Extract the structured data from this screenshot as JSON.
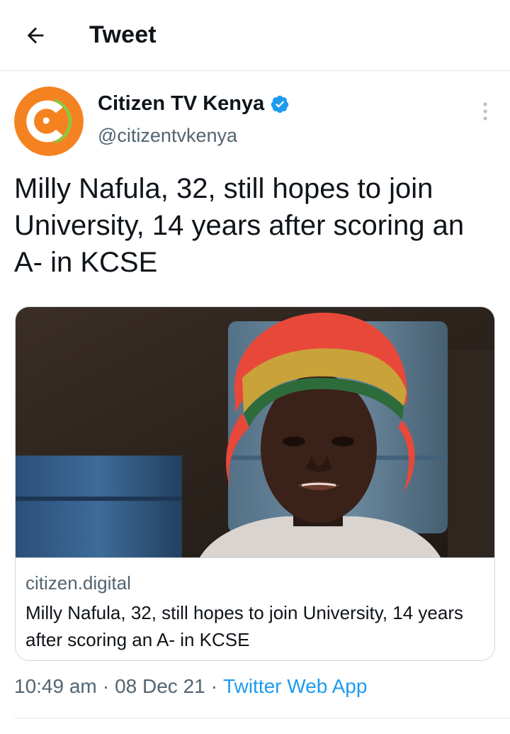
{
  "topbar": {
    "back_icon": "arrow-left-icon",
    "title": "Tweet"
  },
  "author": {
    "display_name": "Citizen TV Kenya",
    "handle": "@citizentvkenya",
    "verified": true,
    "verified_color": "#1d9bf0",
    "avatar_colors": {
      "orange": "#f58220",
      "green": "#8dc63f"
    }
  },
  "tweet": {
    "text": "Milly Nafula, 32, still hopes to join University, 14 years after scoring an A- in KCSE"
  },
  "link_card": {
    "image_icon": "news-photo",
    "domain": "citizen.digital",
    "title": "Milly Nafula, 32, still hopes to join University, 14 years after scoring an A- in KCSE"
  },
  "meta": {
    "time": "10:49 am",
    "separator": "·",
    "date": "08 Dec 21",
    "source": "Twitter Web App",
    "source_color": "#1d9bf0"
  }
}
